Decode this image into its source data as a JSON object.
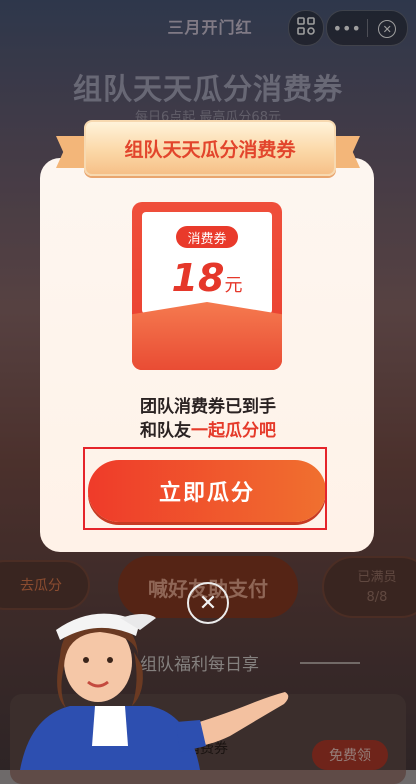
{
  "topbar": {
    "title": "三月开门红",
    "scan_icon": "scan-icon",
    "more_label": "•••",
    "close_label": "✕"
  },
  "page": {
    "headline": "组队天天瓜分消费券",
    "subheadline": "每日6点起 最高瓜分68元"
  },
  "modal": {
    "ribbon_title": "组队天天瓜分消费券",
    "coupon_tag": "消费券",
    "coupon_amount": "18",
    "coupon_unit": "元",
    "message_line1": "团队消费券已到手",
    "message_line2_prefix": "和队友",
    "message_line2_highlight": "一起瓜分吧",
    "cta_label": "立即瓜分",
    "close_label": "✕"
  },
  "background": {
    "left_pill": "去瓜分",
    "center_pill": "喊好友助支付",
    "right_pill_title": "已满员",
    "right_pill_count": "8/8",
    "section_title": "组队福利每日享",
    "card_text": "组起消费券",
    "free_button": "免费领"
  },
  "colors": {
    "accent": "#e93a2b",
    "cta_start": "#ef3b2a",
    "cta_end": "#f0702f",
    "focus_box": "#e5242a"
  }
}
